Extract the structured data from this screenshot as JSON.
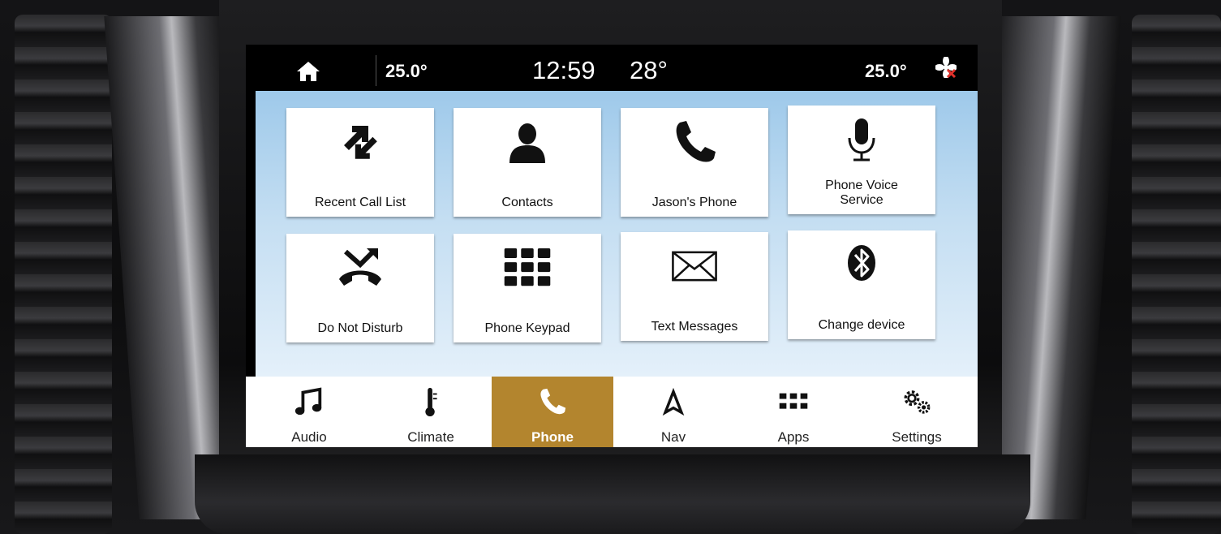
{
  "status_bar": {
    "cabin_temp_left": "25.0°",
    "time": "12:59",
    "outside_temp": "28°",
    "cabin_temp_right": "25.0°",
    "home_icon": "home-icon",
    "fan_icon": "fan-off-icon"
  },
  "phone_menu": {
    "tiles": [
      {
        "label": "Recent Call List",
        "icon": "recent-calls-icon"
      },
      {
        "label": "Contacts",
        "icon": "contact-person-icon"
      },
      {
        "label": "Jason's Phone",
        "icon": "phone-handset-icon"
      },
      {
        "label": "Phone Voice Service",
        "icon": "microphone-icon"
      },
      {
        "label": "Do Not Disturb",
        "icon": "do-not-disturb-icon"
      },
      {
        "label": "Phone Keypad",
        "icon": "keypad-icon"
      },
      {
        "label": "Text Messages",
        "icon": "envelope-icon"
      },
      {
        "label": "Change device",
        "icon": "bluetooth-icon"
      }
    ]
  },
  "nav_bar": {
    "items": [
      {
        "label": "Audio",
        "icon": "music-note-icon"
      },
      {
        "label": "Climate",
        "icon": "thermometer-icon"
      },
      {
        "label": "Phone",
        "icon": "phone-handset-icon",
        "active": true
      },
      {
        "label": "Nav",
        "icon": "navigation-arrow-icon"
      },
      {
        "label": "Apps",
        "icon": "apps-grid-icon"
      },
      {
        "label": "Settings",
        "icon": "gears-icon"
      }
    ],
    "active_color": "#b3852e"
  },
  "colors": {
    "screen_background_top": "#9ec9ea",
    "screen_background_bottom": "#e4f0fa",
    "status_bar": "#000000"
  }
}
